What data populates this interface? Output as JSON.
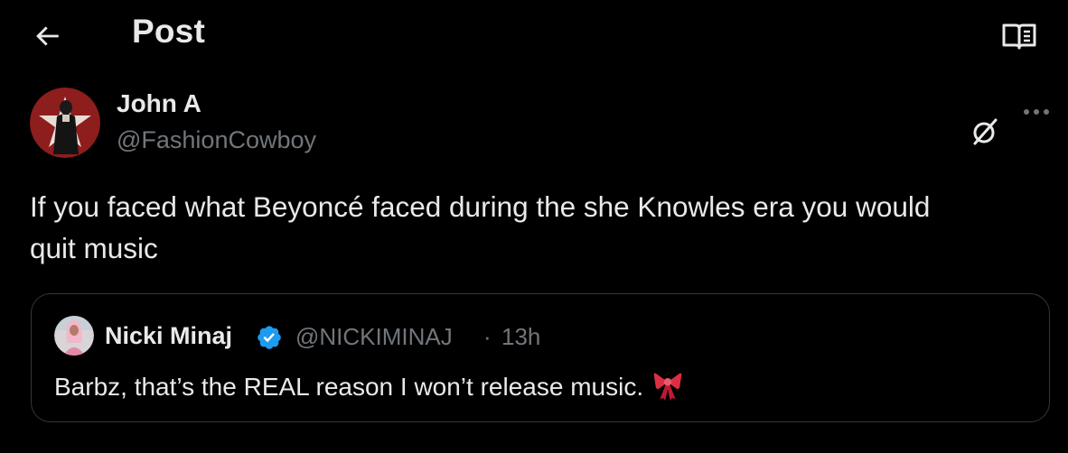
{
  "header": {
    "title": "Post",
    "back_icon": "arrow-left-icon",
    "reader_icon": "reader-mode-icon"
  },
  "post": {
    "author_name": "John A",
    "author_handle": "@FashionCowboy",
    "avatar_icon": "user-avatar",
    "grok_icon": "grok-icon",
    "more_icon": "more-horizontal-icon",
    "text": "If you faced what Beyoncé faced during the she Knowles era you would\nquit music"
  },
  "quote": {
    "author_name": "Nicki Minaj",
    "verified_icon": "verified-badge-icon",
    "author_handle": "@NICKIMINAJ",
    "separator": "·",
    "time": "13h",
    "text": "Barbz, that’s the REAL reason I won’t release music.",
    "emoji_icon": "ribbon-emoji"
  },
  "colors": {
    "background": "#000000",
    "primary_text": "#e7e9ea",
    "secondary_text": "#71767b",
    "border": "#333639",
    "verified_blue": "#1d9bf0",
    "ribbon_red": "#dd2e44"
  }
}
